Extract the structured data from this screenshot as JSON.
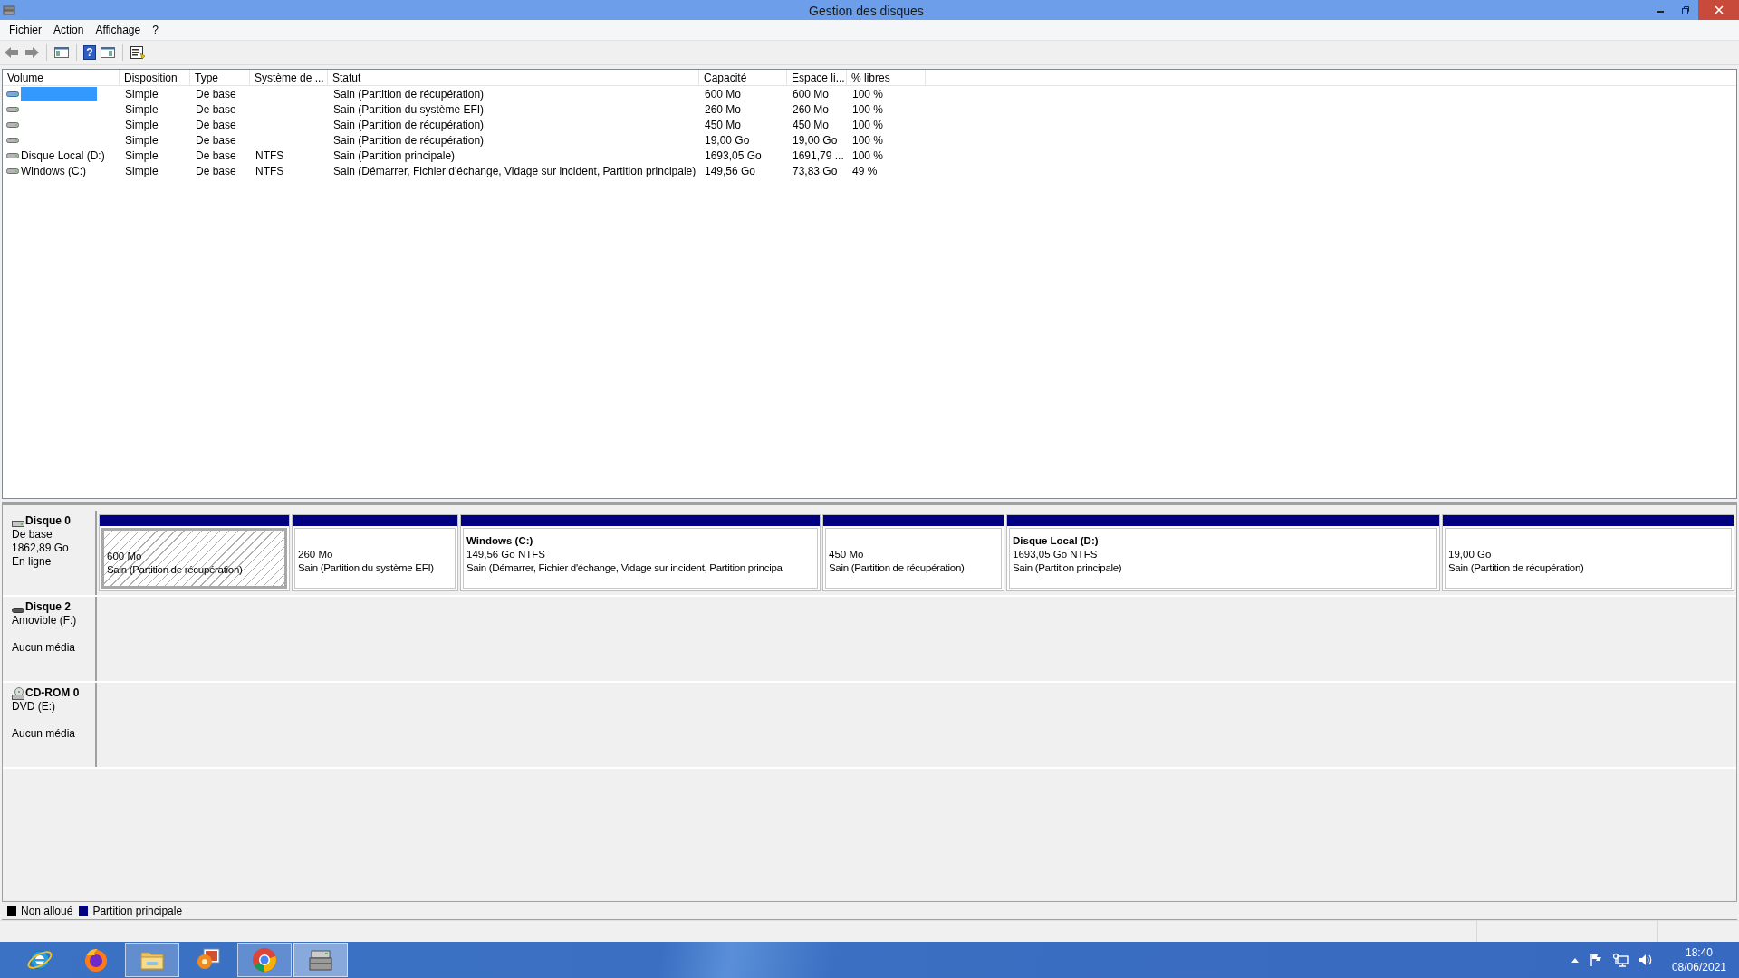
{
  "window": {
    "title": "Gestion des disques"
  },
  "menu": [
    {
      "label": "Fichier"
    },
    {
      "label": "Action"
    },
    {
      "label": "Affichage"
    },
    {
      "label": "?"
    }
  ],
  "toolbar": {
    "help_glyph": "?"
  },
  "table": {
    "columns": [
      "Volume",
      "Disposition",
      "Type",
      "Système de ...",
      "Statut",
      "Capacité",
      "Espace li...",
      "% libres"
    ],
    "rows": [
      {
        "selected": true,
        "disposition": "Simple",
        "type": "De base",
        "status": "Sain (Partition de récupération)",
        "capacity": "600 Mo",
        "free_space": "600 Mo",
        "percent_free": "100 %"
      },
      {
        "selected": false,
        "disposition": "Simple",
        "type": "De base",
        "status": "Sain (Partition du système EFI)",
        "capacity": "260 Mo",
        "free_space": "260 Mo",
        "percent_free": "100 %"
      },
      {
        "selected": false,
        "disposition": "Simple",
        "type": "De base",
        "status": "Sain (Partition de récupération)",
        "capacity": "450 Mo",
        "free_space": "450 Mo",
        "percent_free": "100 %"
      },
      {
        "selected": false,
        "disposition": "Simple",
        "type": "De base",
        "status": "Sain (Partition de récupération)",
        "capacity": "19,00 Go",
        "free_space": "19,00 Go",
        "percent_free": "100 %"
      },
      {
        "selected": false,
        "volume": "Disque Local  (D:)",
        "disposition": "Simple",
        "type": "De base",
        "filesystem": "NTFS",
        "status": "Sain (Partition principale)",
        "capacity": "1693,05 Go",
        "free_space": "1691,79 ...",
        "percent_free": "100 %"
      },
      {
        "selected": false,
        "volume": "Windows (C:)",
        "disposition": "Simple",
        "type": "De base",
        "filesystem": "NTFS",
        "status": "Sain (Démarrer, Fichier d'échange, Vidage sur incident, Partition principale)",
        "capacity": "149,56 Go",
        "free_space": "73,83 Go",
        "percent_free": "49 %"
      }
    ]
  },
  "disks": [
    {
      "kind": "hdd",
      "name": "Disque 0",
      "type": "De base",
      "size": "1862,89 Go",
      "state": "En ligne",
      "partitions": [
        {
          "selected": true,
          "size": "600 Mo",
          "status": "Sain (Partition de récupération)"
        },
        {
          "selected": false,
          "size": "260 Mo",
          "status": "Sain (Partition du système EFI)"
        },
        {
          "selected": false,
          "name": "Windows  (C:)",
          "size": "149,56 Go NTFS",
          "status": "Sain (Démarrer, Fichier d'échange, Vidage sur incident, Partition principa"
        },
        {
          "selected": false,
          "size": "450 Mo",
          "status": "Sain (Partition de récupération)"
        },
        {
          "selected": false,
          "name": "Disque Local   (D:)",
          "size": "1693,05 Go NTFS",
          "status": "Sain (Partition principale)"
        },
        {
          "selected": false,
          "size": "19,00 Go",
          "status": "Sain (Partition de récupération)"
        }
      ]
    },
    {
      "kind": "removable",
      "name": "Disque 2",
      "type": "Amovible (F:)",
      "state": "Aucun média"
    },
    {
      "kind": "cdrom",
      "name": "CD-ROM 0",
      "type": "DVD (E:)",
      "state": "Aucun média"
    }
  ],
  "legend": [
    {
      "label": "Non alloué",
      "color": "#000000"
    },
    {
      "label": "Partition principale",
      "color": "#000080"
    }
  ],
  "taskbar": {
    "apps": [
      {
        "kind": "ie",
        "running": false,
        "selected": false
      },
      {
        "kind": "firefox",
        "running": false,
        "selected": false
      },
      {
        "kind": "explorer",
        "running": true,
        "selected": false
      },
      {
        "kind": "photos",
        "running": false,
        "selected": false
      },
      {
        "kind": "chrome",
        "running": true,
        "selected": false
      },
      {
        "kind": "diskmgmt",
        "running": true,
        "selected": true
      }
    ],
    "tray": {
      "time": "18:40",
      "date": "08/06/2021"
    }
  }
}
